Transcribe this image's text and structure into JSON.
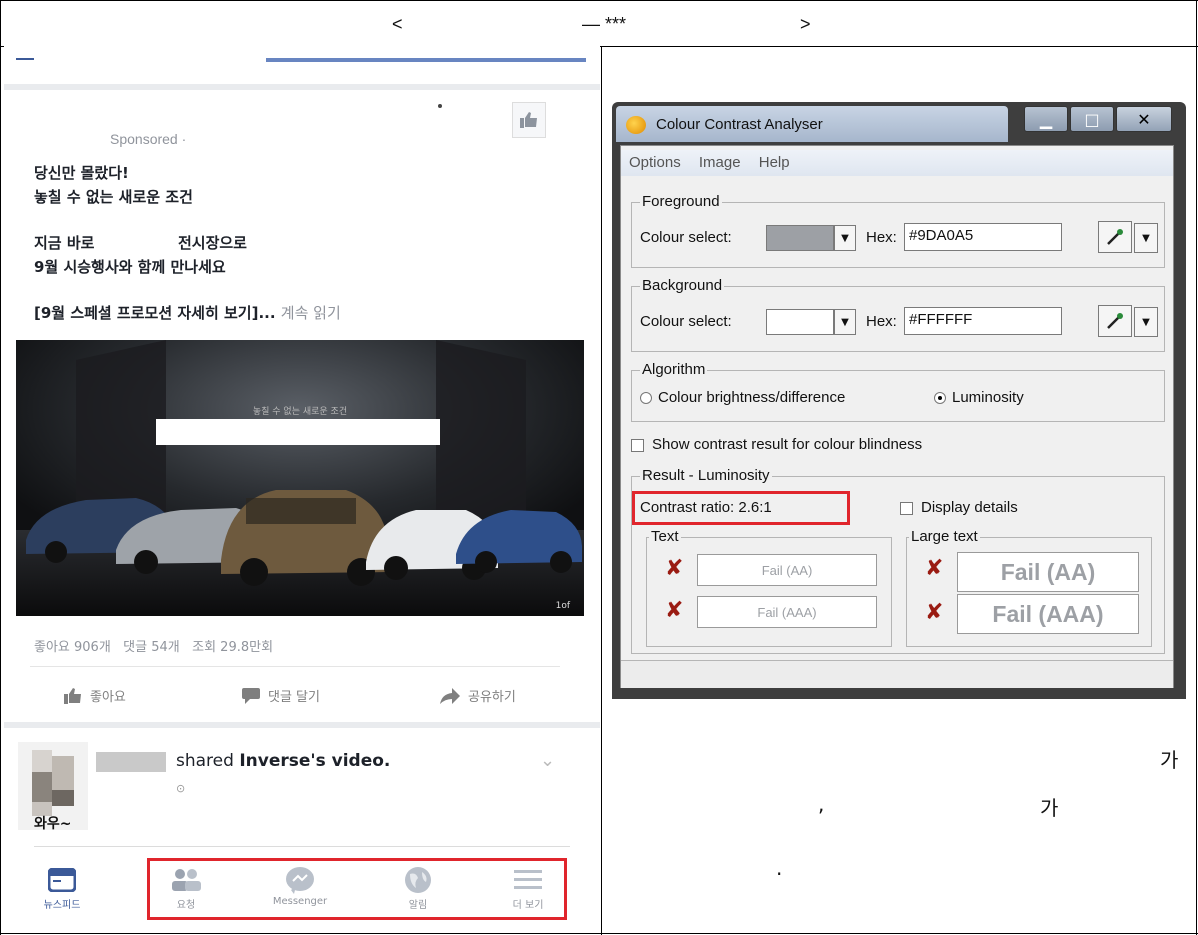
{
  "header": {
    "left_angle": "<",
    "dash_stars": "— ***",
    "right_angle": ">"
  },
  "facebook": {
    "sponsored": "Sponsored · ",
    "post_lines": [
      "당신만 몰랐다!",
      "놓칠 수 없는 새로운 조건",
      "지금 바로                전시장으로",
      "9월 시승행사와 함께 만나세요",
      "[9월 스페셜 프로모션 자세히 보기]..."
    ],
    "read_more": "계속 읽기",
    "image_caption": "놓칠 수 없는 새로운 조건",
    "image_corner": "1of",
    "stats": "좋아요 906개   댓글 54개   조회 29.8만회",
    "actions": {
      "like": "좋아요",
      "comment": "댓글 달기",
      "share": "공유하기"
    },
    "shared_prefix": "shared ",
    "shared_bold": "Inverse's video.",
    "comment_text": "와우~",
    "nav": {
      "newsfeed": "뉴스피드",
      "requests": "요청",
      "messenger": "Messenger",
      "notifications": "알림",
      "more": "더 보기"
    }
  },
  "analyser": {
    "title": "Colour Contrast Analyser",
    "menu": [
      "Options",
      "Image",
      "Help"
    ],
    "foreground": {
      "label": "Foreground",
      "colour_select": "Colour select:",
      "hex_label": "Hex:",
      "hex_value": "#9DA0A5",
      "swatch": "#9DA0A5"
    },
    "background": {
      "label": "Background",
      "colour_select": "Colour select:",
      "hex_label": "Hex:",
      "hex_value": "#FFFFFF",
      "swatch": "#FFFFFF"
    },
    "algorithm": {
      "label": "Algorithm",
      "option1": "Colour brightness/difference",
      "option2": "Luminosity",
      "selected": "Luminosity"
    },
    "colour_blindness": "Show contrast result for colour blindness",
    "result": {
      "label": "Result - Luminosity",
      "contrast_ratio": "Contrast ratio: 2.6:1",
      "display_details": "Display details",
      "text_group": "Text",
      "large_text_group": "Large text",
      "text_aa": "Fail (AA)",
      "text_aaa": "Fail (AAA)",
      "large_aa": "Fail (AA)",
      "large_aaa": "Fail (AAA)"
    }
  },
  "right_text": {
    "ga1": "가",
    "comma": ",",
    "ga2": "가",
    "period": "."
  },
  "colors": {
    "highlight_red": "#e0252c",
    "fb_blue": "#3b5998",
    "fail_x": "#9a1b12"
  }
}
